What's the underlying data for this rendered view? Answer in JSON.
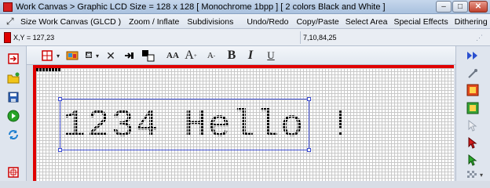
{
  "window": {
    "title": "Work Canvas > Graphic LCD Size = 128 x 128 [ Monochrome 1bpp ] [ 2 colors Black and White ]",
    "minimize": "–",
    "maximize": "□",
    "close": "✕"
  },
  "menu": {
    "items": [
      "Size Work Canvas (GLCD )",
      "Zoom / Inflate",
      "Subdivisions",
      "Undo/Redo",
      "Copy/Paste",
      "Select Area",
      "Special Effects",
      "Dithering"
    ]
  },
  "status": {
    "coords": "X,Y = 127,23",
    "color_value": "7,10,84,25"
  },
  "toolbar": {
    "font_size_label": "AA",
    "grow_label": "A",
    "shrink_label": "A",
    "bold_label": "B",
    "italic_label": "I",
    "underline_label": "U"
  },
  "canvas": {
    "text": "1234 Hello !"
  },
  "colors": {
    "accent_red": "#e00000",
    "selection_blue": "#3c4bd0"
  }
}
